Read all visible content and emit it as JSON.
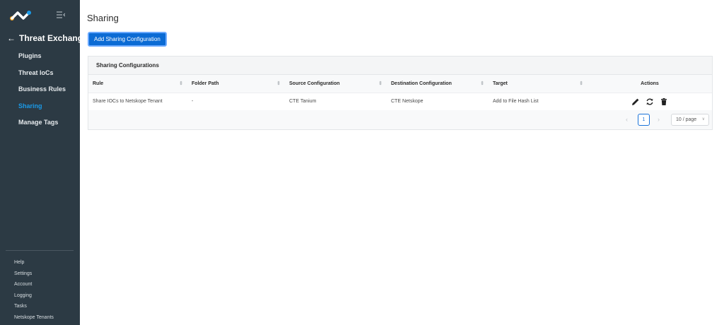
{
  "sidebar": {
    "app_title": "Threat Exchange",
    "nav_items": [
      {
        "label": "Plugins",
        "active": false
      },
      {
        "label": "Threat IoCs",
        "active": false
      },
      {
        "label": "Business Rules",
        "active": false
      },
      {
        "label": "Sharing",
        "active": true
      },
      {
        "label": "Manage Tags",
        "active": false
      }
    ],
    "bottom_items": [
      "Help",
      "Settings",
      "Account",
      "Logging",
      "Tasks",
      "Netskope Tenants"
    ]
  },
  "page": {
    "title": "Sharing",
    "add_button_label": "Add Sharing Configuration"
  },
  "panel": {
    "title": "Sharing Configurations",
    "columns": [
      "Rule",
      "Folder Path",
      "Source Configuration",
      "Destination Configuration",
      "Target",
      "Actions"
    ],
    "rows": [
      {
        "rule": "Share IOCs to Netskope Tenant",
        "folder_path": "-",
        "source": "CTE Tanium",
        "destination": "CTE Netskope",
        "target": "Add to File Hash List"
      }
    ]
  },
  "pagination": {
    "current_page": "1",
    "page_size": "10 / page"
  },
  "colors": {
    "sidebar_bg": "#2c3a44",
    "accent": "#1a9ae8",
    "primary_button": "#0b6bd4"
  }
}
